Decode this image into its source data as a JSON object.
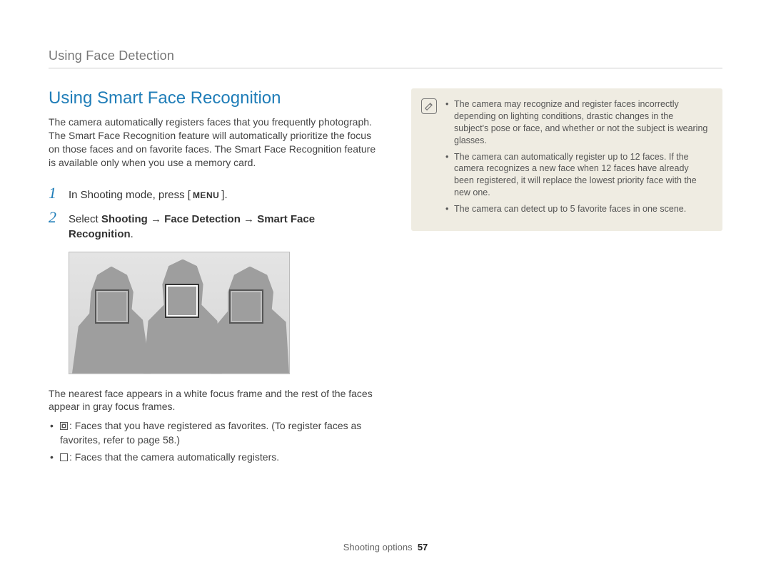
{
  "breadcrumb": "Using Face Detection",
  "section_title": "Using Smart Face Recognition",
  "intro": "The camera automatically registers faces that you frequently photograph. The Smart Face Recognition feature will automatically prioritize the focus on those faces and on favorite faces. The Smart Face Recognition feature is available only when you use a memory card.",
  "steps": [
    {
      "num": "1",
      "prefix": "In Shooting mode, press [",
      "menu": "MENU",
      "suffix": "]."
    },
    {
      "num": "2",
      "prefix": "Select ",
      "bold": "Shooting → Face Detection → Smart Face Recognition",
      "suffix": "."
    }
  ],
  "caption": "The nearest face appears in a white focus frame and the rest of the faces appear in gray focus frames.",
  "legend": {
    "double": ": Faces that you have registered as favorites. (To register faces as favorites, refer to page 58.)",
    "single": ": Faces that the camera automatically registers."
  },
  "notes": [
    "The camera may recognize and register faces incorrectly depending on lighting conditions, drastic changes in the subject's pose or face, and whether or not the subject is wearing glasses.",
    "The camera can automatically register up to 12 faces. If the camera recognizes a new face when 12 faces have already been registered, it will replace the lowest priority face with the new one.",
    "The camera can detect up to 5 favorite faces in one scene."
  ],
  "footer": {
    "section": "Shooting options",
    "page": "57"
  },
  "icons": {
    "note": "note-pencil-icon",
    "menu_btn": "menu-button-label",
    "fav_frame": "favorite-face-frame-icon",
    "auto_frame": "auto-face-frame-icon"
  }
}
